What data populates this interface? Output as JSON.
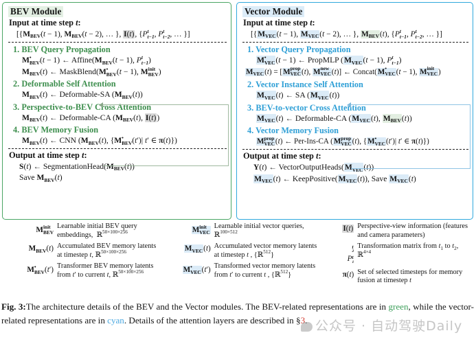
{
  "bev_module": {
    "title": "BEV Module",
    "input_label": "Input at time step t:",
    "input_formula": "[{M_BEV(t-1), M_BEV(t-2), ... }, I(t), {P^t_{t-1}, P^t_{t-2}, ... }]",
    "steps": [
      {
        "number": "1.",
        "title": "BEV Query Propagation",
        "lines": [
          "M*_BEV(t-1) <- Affine(M_BEV(t-1), P^t_{t-1})",
          "M_BEV(t) <- MaskBlend(M*_BEV(t-1), M^init_BEV)"
        ]
      },
      {
        "number": "2.",
        "title": "Deformable Self Attention",
        "lines": [
          "M_BEV(t) <- Deformable-SA (M_BEV(t))"
        ]
      },
      {
        "number": "3.",
        "title": "Perspective-to-BEV Cross Attention",
        "lines": [
          "M_BEV(t) <- Deformable-CA (M_BEV(t), I(t))"
        ]
      },
      {
        "number": "4.",
        "title": "BEV Memory Fusion",
        "lines": [
          "M_BEV(t) <- CNN (M_BEV(t), {M*_BEV(t')| t' in pi(t)})"
        ]
      }
    ],
    "output_label": "Output at time step t:",
    "output_lines": [
      "S(t) <- SegmentationHead(M_BEV(t))",
      "Save M_BEV(t)"
    ]
  },
  "vector_module": {
    "title": "Vector Module",
    "input_label": "Input at time step t:",
    "input_formula": "[{M_VEC(t-1), M_VEC(t-2), ... }, M_BEV(t), {P^t_{t-1}, P^t_{t-2}, ... }]",
    "steps": [
      {
        "number": "1.",
        "title": "Vector Query Propagation",
        "lines": [
          "M*_VEC(t-1) <- PropMLP (M_VEC(t-1), P^t_{t-1})",
          "M_VEC(t) = [M^prop_VEC(t), M^new_VEC(t)] <- Concat(M*_VEC(t-1), M^init_VEC)"
        ]
      },
      {
        "number": "2.",
        "title": "Vector Instance Self Attention",
        "lines": [
          "M_VEC(t) <- SA (M_VEC(t))"
        ]
      },
      {
        "number": "3.",
        "title": "BEV-to-vector Cross Attention",
        "lines": [
          "M_VEC(t) <- Deformable-CA (M_VEC(t), M_BEV(t))"
        ]
      },
      {
        "number": "4.",
        "title": "Vector Memory Fusion",
        "lines": [
          "M^prop_VEC(t) <- Per-Ins-CA (M^prop_VEC(t), {M*_VEC(t')| t' in pi(t)})"
        ]
      }
    ],
    "output_label": "Output at time step t:",
    "output_lines": [
      "Y(t) <- VectorOutputHeads(M_VEC(t))",
      "M_VEC(t) <- KeepPositive(M_VEC(t)), Save M_VEC(t)"
    ]
  },
  "legend": {
    "column1": [
      {
        "symbol": "M^init_BEV",
        "description": "Learnable initial BEV query embeddings, R^(50x100x256)"
      },
      {
        "symbol": "M_BEV(t)",
        "description": "Accumulated BEV memory latents at timestep t, R^(50x100x256)"
      },
      {
        "symbol": "M*_BEV(t')",
        "description": "Transformer BEV memory latents from t' to current t, R^(50x100x256)"
      }
    ],
    "column2": [
      {
        "symbol": "M^init_VEC",
        "description": "Learnable initial vector queries, R^(100x512)"
      },
      {
        "symbol": "M_VEC(t)",
        "description": "Accumulated vector memory latents at timestep t , {R^512}"
      },
      {
        "symbol": "M*_VEC(t')",
        "description": "Transformed vector memory latents from t' to current t , {R^512}"
      }
    ],
    "column3": [
      {
        "symbol": "I(t)",
        "description": "Perspective-view information (features and camera parameters)"
      },
      {
        "symbol": "P^{t2}_{t1}",
        "description": "Transformation matrix from t1 to t2, R^(4x4)"
      },
      {
        "symbol": "pi(t)",
        "description": "Set of selected timesteps for memory fusion at timestep t"
      }
    ]
  },
  "caption": {
    "figure_number": "Fig. 3:",
    "text_1": "The architecture details of the BEV and the Vector modules. The BEV-related representations are in ",
    "green_word": "green",
    "text_2": ", while the vector-related representations are in ",
    "cyan_word": "cyan",
    "text_3": ". Details of the attention layers are described in §",
    "section_ref": "3",
    "text_4": "."
  },
  "watermark": {
    "text": "公众号 · 自动驾驶Daily"
  },
  "colors": {
    "bev_accent": "#3e8f4e",
    "vec_accent": "#2e9fd6",
    "bev_border": "#4aa564",
    "vec_border": "#2fa8dd",
    "caption_green": "#3fa05c",
    "caption_cyan": "#4aa8e0",
    "caption_red": "#d23b32"
  }
}
